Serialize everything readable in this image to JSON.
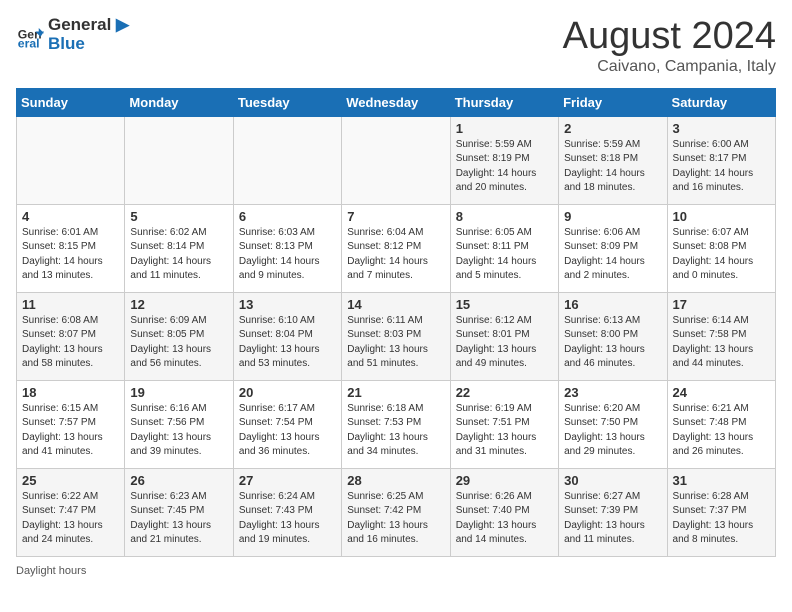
{
  "logo": {
    "line1": "General",
    "line2": "Blue"
  },
  "title": "August 2024",
  "subtitle": "Caivano, Campania, Italy",
  "days_of_week": [
    "Sunday",
    "Monday",
    "Tuesday",
    "Wednesday",
    "Thursday",
    "Friday",
    "Saturday"
  ],
  "footer_label": "Daylight hours",
  "weeks": [
    [
      {
        "day": "",
        "info": ""
      },
      {
        "day": "",
        "info": ""
      },
      {
        "day": "",
        "info": ""
      },
      {
        "day": "",
        "info": ""
      },
      {
        "day": "1",
        "info": "Sunrise: 5:59 AM\nSunset: 8:19 PM\nDaylight: 14 hours\nand 20 minutes."
      },
      {
        "day": "2",
        "info": "Sunrise: 5:59 AM\nSunset: 8:18 PM\nDaylight: 14 hours\nand 18 minutes."
      },
      {
        "day": "3",
        "info": "Sunrise: 6:00 AM\nSunset: 8:17 PM\nDaylight: 14 hours\nand 16 minutes."
      }
    ],
    [
      {
        "day": "4",
        "info": "Sunrise: 6:01 AM\nSunset: 8:15 PM\nDaylight: 14 hours\nand 13 minutes."
      },
      {
        "day": "5",
        "info": "Sunrise: 6:02 AM\nSunset: 8:14 PM\nDaylight: 14 hours\nand 11 minutes."
      },
      {
        "day": "6",
        "info": "Sunrise: 6:03 AM\nSunset: 8:13 PM\nDaylight: 14 hours\nand 9 minutes."
      },
      {
        "day": "7",
        "info": "Sunrise: 6:04 AM\nSunset: 8:12 PM\nDaylight: 14 hours\nand 7 minutes."
      },
      {
        "day": "8",
        "info": "Sunrise: 6:05 AM\nSunset: 8:11 PM\nDaylight: 14 hours\nand 5 minutes."
      },
      {
        "day": "9",
        "info": "Sunrise: 6:06 AM\nSunset: 8:09 PM\nDaylight: 14 hours\nand 2 minutes."
      },
      {
        "day": "10",
        "info": "Sunrise: 6:07 AM\nSunset: 8:08 PM\nDaylight: 14 hours\nand 0 minutes."
      }
    ],
    [
      {
        "day": "11",
        "info": "Sunrise: 6:08 AM\nSunset: 8:07 PM\nDaylight: 13 hours\nand 58 minutes."
      },
      {
        "day": "12",
        "info": "Sunrise: 6:09 AM\nSunset: 8:05 PM\nDaylight: 13 hours\nand 56 minutes."
      },
      {
        "day": "13",
        "info": "Sunrise: 6:10 AM\nSunset: 8:04 PM\nDaylight: 13 hours\nand 53 minutes."
      },
      {
        "day": "14",
        "info": "Sunrise: 6:11 AM\nSunset: 8:03 PM\nDaylight: 13 hours\nand 51 minutes."
      },
      {
        "day": "15",
        "info": "Sunrise: 6:12 AM\nSunset: 8:01 PM\nDaylight: 13 hours\nand 49 minutes."
      },
      {
        "day": "16",
        "info": "Sunrise: 6:13 AM\nSunset: 8:00 PM\nDaylight: 13 hours\nand 46 minutes."
      },
      {
        "day": "17",
        "info": "Sunrise: 6:14 AM\nSunset: 7:58 PM\nDaylight: 13 hours\nand 44 minutes."
      }
    ],
    [
      {
        "day": "18",
        "info": "Sunrise: 6:15 AM\nSunset: 7:57 PM\nDaylight: 13 hours\nand 41 minutes."
      },
      {
        "day": "19",
        "info": "Sunrise: 6:16 AM\nSunset: 7:56 PM\nDaylight: 13 hours\nand 39 minutes."
      },
      {
        "day": "20",
        "info": "Sunrise: 6:17 AM\nSunset: 7:54 PM\nDaylight: 13 hours\nand 36 minutes."
      },
      {
        "day": "21",
        "info": "Sunrise: 6:18 AM\nSunset: 7:53 PM\nDaylight: 13 hours\nand 34 minutes."
      },
      {
        "day": "22",
        "info": "Sunrise: 6:19 AM\nSunset: 7:51 PM\nDaylight: 13 hours\nand 31 minutes."
      },
      {
        "day": "23",
        "info": "Sunrise: 6:20 AM\nSunset: 7:50 PM\nDaylight: 13 hours\nand 29 minutes."
      },
      {
        "day": "24",
        "info": "Sunrise: 6:21 AM\nSunset: 7:48 PM\nDaylight: 13 hours\nand 26 minutes."
      }
    ],
    [
      {
        "day": "25",
        "info": "Sunrise: 6:22 AM\nSunset: 7:47 PM\nDaylight: 13 hours\nand 24 minutes."
      },
      {
        "day": "26",
        "info": "Sunrise: 6:23 AM\nSunset: 7:45 PM\nDaylight: 13 hours\nand 21 minutes."
      },
      {
        "day": "27",
        "info": "Sunrise: 6:24 AM\nSunset: 7:43 PM\nDaylight: 13 hours\nand 19 minutes."
      },
      {
        "day": "28",
        "info": "Sunrise: 6:25 AM\nSunset: 7:42 PM\nDaylight: 13 hours\nand 16 minutes."
      },
      {
        "day": "29",
        "info": "Sunrise: 6:26 AM\nSunset: 7:40 PM\nDaylight: 13 hours\nand 14 minutes."
      },
      {
        "day": "30",
        "info": "Sunrise: 6:27 AM\nSunset: 7:39 PM\nDaylight: 13 hours\nand 11 minutes."
      },
      {
        "day": "31",
        "info": "Sunrise: 6:28 AM\nSunset: 7:37 PM\nDaylight: 13 hours\nand 8 minutes."
      }
    ]
  ]
}
